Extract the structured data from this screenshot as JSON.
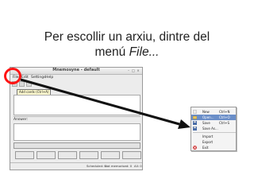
{
  "slide": {
    "title_line1": "Per escollir un arxiu, dintre del",
    "title_line2_prefix": "menú ",
    "title_line2_emph": "File..."
  },
  "window": {
    "title": "Mnemosyne - default",
    "menu": [
      "File",
      "Edit",
      "Settings",
      "Help"
    ],
    "tooltip": "Add cards (Ctrl+A)",
    "answer_label": "Answer:",
    "status": {
      "scheduled": "Scheduled: 0",
      "not_memorised": "Not memorised: 0",
      "all": "All: 0"
    }
  },
  "file_menu": {
    "items": [
      {
        "label": "New",
        "shortcut": "Ctrl+N",
        "icon": "new-file-icon",
        "selected": false
      },
      {
        "label": "Open...",
        "shortcut": "Ctrl+O",
        "icon": "open-folder-icon",
        "selected": true
      },
      {
        "label": "Save",
        "shortcut": "Ctrl+S",
        "icon": "save-icon",
        "selected": false
      },
      {
        "label": "Save As...",
        "shortcut": "",
        "icon": "save-as-icon",
        "selected": false
      },
      {
        "label": "Import",
        "shortcut": "",
        "icon": "",
        "selected": false
      },
      {
        "label": "Export",
        "shortcut": "",
        "icon": "",
        "selected": false
      },
      {
        "label": "Exit",
        "shortcut": "",
        "icon": "exit-icon",
        "selected": false
      }
    ]
  },
  "colors": {
    "highlight_circle": "#ff1414",
    "arrow": "#111111",
    "menu_selection": "#6a8ec8"
  }
}
